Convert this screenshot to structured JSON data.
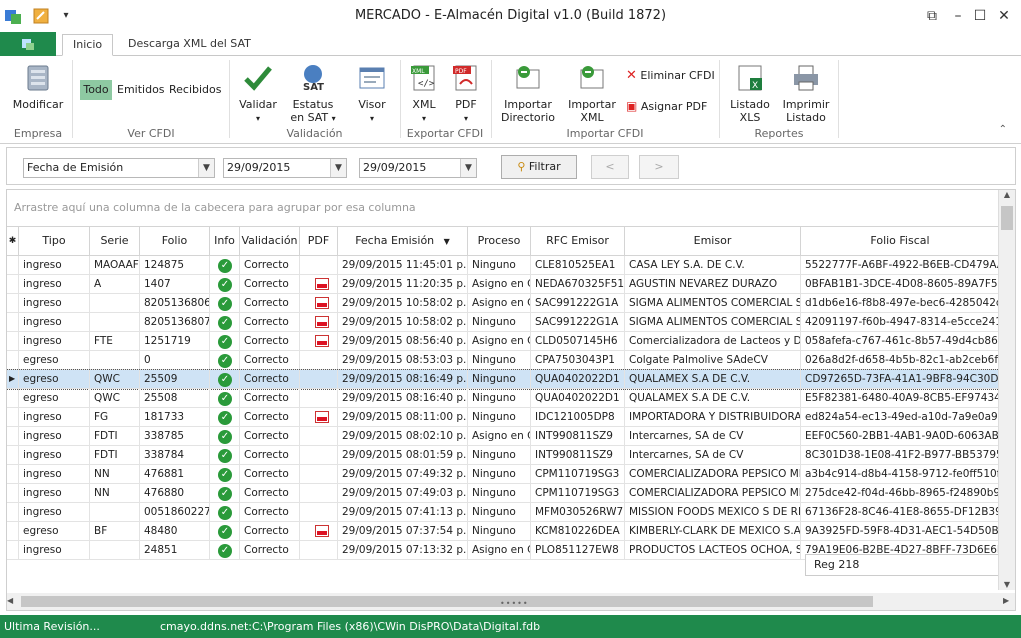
{
  "window": {
    "title": "MERCADO - E-Almacén Digital v1.0 (Build 1872)"
  },
  "tabs": [
    {
      "label": "Inicio"
    },
    {
      "label": "Descarga XML del SAT"
    }
  ],
  "ribbon": {
    "empresa": {
      "modificar": "Modificar",
      "group": "Empresa"
    },
    "ver": {
      "todo": "Todo",
      "emitidos": "Emitidos",
      "recibidos": "Recibidos",
      "group": "Ver CFDI"
    },
    "validacion": {
      "validar": "Validar",
      "estatus1": "Estatus",
      "estatus2": "en SAT",
      "visor": "Visor",
      "group": "Validación"
    },
    "exportar": {
      "xml": "XML",
      "pdf": "PDF",
      "group": "Exportar CFDI"
    },
    "importar": {
      "dir1": "Importar",
      "dir2": "Directorio",
      "xml1": "Importar",
      "xml2": "XML",
      "eliminar": "Eliminar CFDI",
      "asignar": "Asignar PDF",
      "group": "Importar CFDI"
    },
    "reportes": {
      "list1": "Listado",
      "list2": "XLS",
      "imp1": "Imprimir",
      "imp2": "Listado",
      "group": "Reportes"
    }
  },
  "filter": {
    "campo": "Fecha de Emisión",
    "desde": "29/09/2015",
    "hasta": "29/09/2015",
    "filtrar": "Filtrar",
    "prev": "<",
    "next": ">"
  },
  "grid": {
    "group_hint": "Arrastre aquí una columna de la cabecera para agrupar por esa columna",
    "headers": {
      "marker": "✱",
      "tipo": "Tipo",
      "serie": "Serie",
      "folio": "Folio",
      "info": "Info",
      "validacion": "Validación",
      "pdf": "PDF",
      "fecha": "Fecha Emisión",
      "proceso": "Proceso",
      "rfc": "RFC Emisor",
      "emisor": "Emisor",
      "folio_fiscal": "Folio Fiscal"
    },
    "rows": [
      {
        "tipo": "ingreso",
        "serie": "MAOAAF",
        "folio": "124875",
        "validacion": "Correcto",
        "pdf": false,
        "fecha": "29/09/2015 11:45:01 p.m.",
        "proceso": "Ninguno",
        "rfc": "CLE810525EA1",
        "emisor": "CASA LEY S.A. DE C.V.",
        "ff": "5522777F-A6BF-4922-B6EB-CD479AA8"
      },
      {
        "tipo": "ingreso",
        "serie": "A",
        "folio": "1407",
        "validacion": "Correcto",
        "pdf": true,
        "fecha": "29/09/2015 11:20:35 p.m.",
        "proceso": "Asigno en C",
        "rfc": "NEDA670325F51",
        "emisor": "AGUSTIN NEVAREZ DURAZO",
        "ff": "0BFAB1B1-3DCE-4D08-8605-89A7F515"
      },
      {
        "tipo": "ingreso",
        "serie": "",
        "folio": "8205136806",
        "validacion": "Correcto",
        "pdf": true,
        "fecha": "29/09/2015 10:58:02 p.m.",
        "proceso": "Asigno en C",
        "rfc": "SAC991222G1A",
        "emisor": "SIGMA ALIMENTOS COMERCIAL S.",
        "ff": "d1db6e16-f8b8-497e-bec6-4285042d8"
      },
      {
        "tipo": "ingreso",
        "serie": "",
        "folio": "8205136807",
        "validacion": "Correcto",
        "pdf": true,
        "fecha": "29/09/2015 10:58:02 p.m.",
        "proceso": "Ninguno",
        "rfc": "SAC991222G1A",
        "emisor": "SIGMA ALIMENTOS COMERCIAL S.",
        "ff": "42091197-f60b-4947-8314-e5cce241cd"
      },
      {
        "tipo": "ingreso",
        "serie": "FTE",
        "folio": "1251719",
        "validacion": "Correcto",
        "pdf": true,
        "fecha": "29/09/2015 08:56:40 p.m.",
        "proceso": "Asigno en C",
        "rfc": "CLD0507145H6",
        "emisor": "Comercializadora de Lacteos y De",
        "ff": "058afefa-c767-461c-8b57-49d4cb8607"
      },
      {
        "tipo": "egreso",
        "serie": "",
        "folio": "0",
        "validacion": "Correcto",
        "pdf": false,
        "fecha": "29/09/2015 08:53:03 p.m.",
        "proceso": "Ninguno",
        "rfc": "CPA7503043P1",
        "emisor": "Colgate Palmolive SAdeCV",
        "ff": "026a8d2f-d658-4b5b-82c1-ab2ceb6fa4"
      },
      {
        "tipo": "egreso",
        "serie": "QWC",
        "folio": "25509",
        "validacion": "Correcto",
        "pdf": false,
        "fecha": "29/09/2015 08:16:49 p.m.",
        "proceso": "Ninguno",
        "rfc": "QUA0402022D1",
        "emisor": "QUALAMEX S.A DE C.V.",
        "ff": "CD97265D-73FA-41A1-9BF8-94C30DE5",
        "selected": true
      },
      {
        "tipo": "egreso",
        "serie": "QWC",
        "folio": "25508",
        "validacion": "Correcto",
        "pdf": false,
        "fecha": "29/09/2015 08:16:40 p.m.",
        "proceso": "Ninguno",
        "rfc": "QUA0402022D1",
        "emisor": "QUALAMEX S.A DE C.V.",
        "ff": "E5F82381-6480-40A9-8CB5-EF9743485"
      },
      {
        "tipo": "ingreso",
        "serie": "FG",
        "folio": "181733",
        "validacion": "Correcto",
        "pdf": true,
        "fecha": "29/09/2015 08:11:00 p.m.",
        "proceso": "Ninguno",
        "rfc": "IDC121005DP8",
        "emisor": "IMPORTADORA Y DISTRIBUIDORA",
        "ff": "ed824a54-ec13-49ed-a10d-7a9e0a94cb"
      },
      {
        "tipo": "ingreso",
        "serie": "FDTI",
        "folio": "338785",
        "validacion": "Correcto",
        "pdf": false,
        "fecha": "29/09/2015 08:02:10 p.m.",
        "proceso": "Asigno en C",
        "rfc": "INT990811SZ9",
        "emisor": "Intercarnes, SA de CV",
        "ff": "EEF0C560-2BB1-4AB1-9A0D-6063ABD9"
      },
      {
        "tipo": "ingreso",
        "serie": "FDTI",
        "folio": "338784",
        "validacion": "Correcto",
        "pdf": false,
        "fecha": "29/09/2015 08:01:59 p.m.",
        "proceso": "Ninguno",
        "rfc": "INT990811SZ9",
        "emisor": "Intercarnes, SA de CV",
        "ff": "8C301D38-1E08-41F2-B977-BB53795ED"
      },
      {
        "tipo": "ingreso",
        "serie": "NN",
        "folio": "476881",
        "validacion": "Correcto",
        "pdf": false,
        "fecha": "29/09/2015 07:49:32 p.m.",
        "proceso": "Ninguno",
        "rfc": "CPM110719SG3",
        "emisor": "COMERCIALIZADORA PEPSICO ME",
        "ff": "a3b4c914-d8b4-4158-9712-fe0ff510f1"
      },
      {
        "tipo": "ingreso",
        "serie": "NN",
        "folio": "476880",
        "validacion": "Correcto",
        "pdf": false,
        "fecha": "29/09/2015 07:49:03 p.m.",
        "proceso": "Ninguno",
        "rfc": "CPM110719SG3",
        "emisor": "COMERCIALIZADORA PEPSICO ME",
        "ff": "275dce42-f04d-46bb-8965-f24890b954"
      },
      {
        "tipo": "ingreso",
        "serie": "",
        "folio": "0051860227",
        "validacion": "Correcto",
        "pdf": false,
        "fecha": "29/09/2015 07:41:13 p.m.",
        "proceso": "Ninguno",
        "rfc": "MFM030526RW7",
        "emisor": "MISSION FOODS MEXICO S DE RL",
        "ff": "67136F28-8C46-41E8-8655-DF12B3943"
      },
      {
        "tipo": "egreso",
        "serie": "BF",
        "folio": "48480",
        "validacion": "Correcto",
        "pdf": true,
        "fecha": "29/09/2015 07:37:54 p.m.",
        "proceso": "Ninguno",
        "rfc": "KCM810226DEA",
        "emisor": "KIMBERLY-CLARK DE MEXICO S.A.",
        "ff": "9A3925FD-59F8-4D31-AEC1-54D50BE6"
      },
      {
        "tipo": "ingreso",
        "serie": "",
        "folio": "24851",
        "validacion": "Correcto",
        "pdf": false,
        "fecha": "29/09/2015 07:13:32 p.m.",
        "proceso": "Asigno en C",
        "rfc": "PLO851127EW8",
        "emisor": "PRODUCTOS LACTEOS OCHOA, S.",
        "ff": "79A19E06-B2BE-4D27-8BFF-73D6E6EB"
      }
    ],
    "footer_count": "Reg 218"
  },
  "status": {
    "left": "Ultima Revisión...",
    "path": "cmayo.ddns.net:C:\\Program Files (x86)\\CWin DisPRO\\Data\\Digital.fdb"
  },
  "colors": {
    "accent": "#1f8a4c",
    "selected_row": "#cfe3f5"
  }
}
